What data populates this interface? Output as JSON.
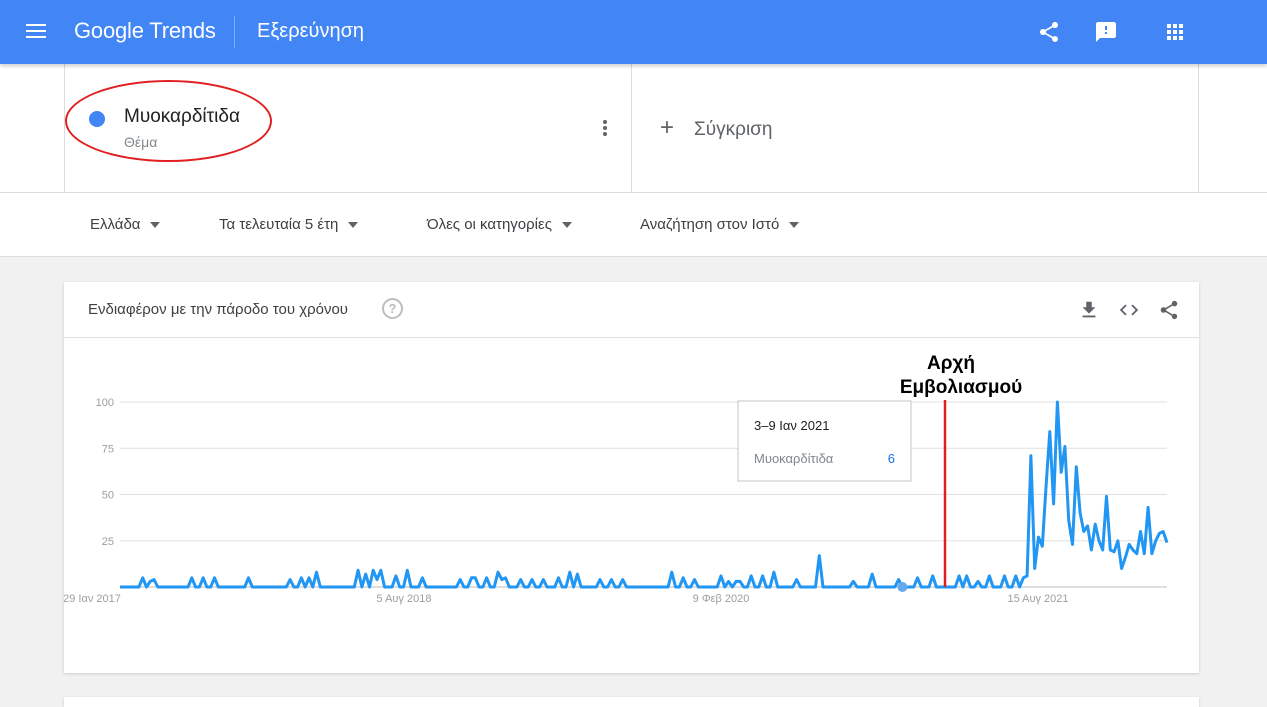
{
  "header": {
    "logo_google": "Google",
    "logo_trends": "Trends",
    "section": "Εξερεύνηση",
    "icons": [
      "menu-icon",
      "share-icon",
      "feedback-icon",
      "apps-icon"
    ],
    "color": "#4285f4"
  },
  "search_term": {
    "name": "Μυοκαρδίτιδα",
    "type": "Θέμα",
    "color": "#4285f4"
  },
  "compare": {
    "plus": "+",
    "label": "Σύγκριση"
  },
  "filters": {
    "region": "Ελλάδα",
    "time": "Τα τελευταία 5 έτη",
    "category": "Όλες οι κατηγορίες",
    "search_type": "Αναζήτηση στον Ιστό"
  },
  "card": {
    "title": "Ενδιαφέρον με την πάροδο του χρόνου",
    "help": "?"
  },
  "annotation": {
    "line1": "Αρχή",
    "line2": "Εμβολιασμού",
    "color": "#e02020"
  },
  "tooltip": {
    "date": "3–9 Ιαν 2021",
    "term": "Μυοκαρδίτιδα",
    "value": "6"
  },
  "chart_data": {
    "type": "line",
    "series": [
      {
        "name": "Μυοκαρδίτιδα",
        "color": "#2196f3"
      }
    ],
    "ylim": [
      0,
      100
    ],
    "yticks": [
      "100",
      "75",
      "50",
      "25"
    ],
    "xtick_labels": [
      "29 Ιαν 2017",
      "5 Αυγ 2018",
      "9 Φεβ 2020",
      "15 Αυγ 2021"
    ],
    "grid": true,
    "weekly_values": [
      0,
      0,
      0,
      0,
      0,
      0,
      5,
      0,
      3,
      4,
      0,
      0,
      0,
      0,
      0,
      0,
      0,
      0,
      0,
      5,
      0,
      0,
      5,
      0,
      0,
      5,
      0,
      0,
      0,
      0,
      0,
      0,
      0,
      0,
      5,
      0,
      0,
      0,
      0,
      0,
      0,
      0,
      0,
      0,
      0,
      4,
      0,
      0,
      5,
      0,
      5,
      0,
      8,
      0,
      0,
      0,
      0,
      0,
      0,
      0,
      0,
      0,
      0,
      9,
      0,
      7,
      0,
      9,
      4,
      9,
      0,
      0,
      0,
      6,
      0,
      0,
      9,
      0,
      0,
      0,
      5,
      0,
      0,
      0,
      0,
      0,
      0,
      0,
      0,
      0,
      4,
      0,
      0,
      5,
      5,
      0,
      0,
      5,
      0,
      0,
      8,
      4,
      5,
      0,
      0,
      0,
      4,
      0,
      0,
      4,
      0,
      0,
      4,
      0,
      0,
      0,
      5,
      0,
      0,
      8,
      0,
      7,
      0,
      0,
      0,
      0,
      0,
      4,
      0,
      0,
      4,
      0,
      0,
      4,
      0,
      0,
      0,
      0,
      0,
      0,
      0,
      0,
      0,
      0,
      0,
      0,
      8,
      0,
      0,
      5,
      0,
      0,
      4,
      0,
      0,
      0,
      0,
      0,
      0,
      6,
      0,
      3,
      0,
      3,
      3,
      0,
      0,
      6,
      0,
      0,
      6,
      0,
      0,
      8,
      0,
      0,
      0,
      0,
      0,
      4,
      0,
      0,
      0,
      0,
      0,
      17,
      0,
      0,
      0,
      0,
      0,
      0,
      0,
      0,
      3,
      0,
      0,
      0,
      0,
      7,
      0,
      0,
      0,
      0,
      0,
      0,
      4,
      0,
      0,
      0,
      0,
      5,
      0,
      0,
      0,
      6,
      0,
      0,
      0,
      0,
      0,
      0,
      6,
      0,
      6,
      0,
      0,
      3,
      0,
      0,
      6,
      0,
      0,
      0,
      6,
      0,
      0,
      6,
      0,
      5,
      6,
      71,
      10,
      27,
      22,
      54,
      84,
      45,
      100,
      62,
      76,
      36,
      23,
      65,
      40,
      30,
      33,
      20,
      34,
      25,
      20,
      49,
      20,
      19,
      25,
      10,
      16,
      23,
      20,
      18,
      30,
      18,
      43,
      18,
      25,
      29,
      30,
      24
    ],
    "highlight_index": 207
  }
}
